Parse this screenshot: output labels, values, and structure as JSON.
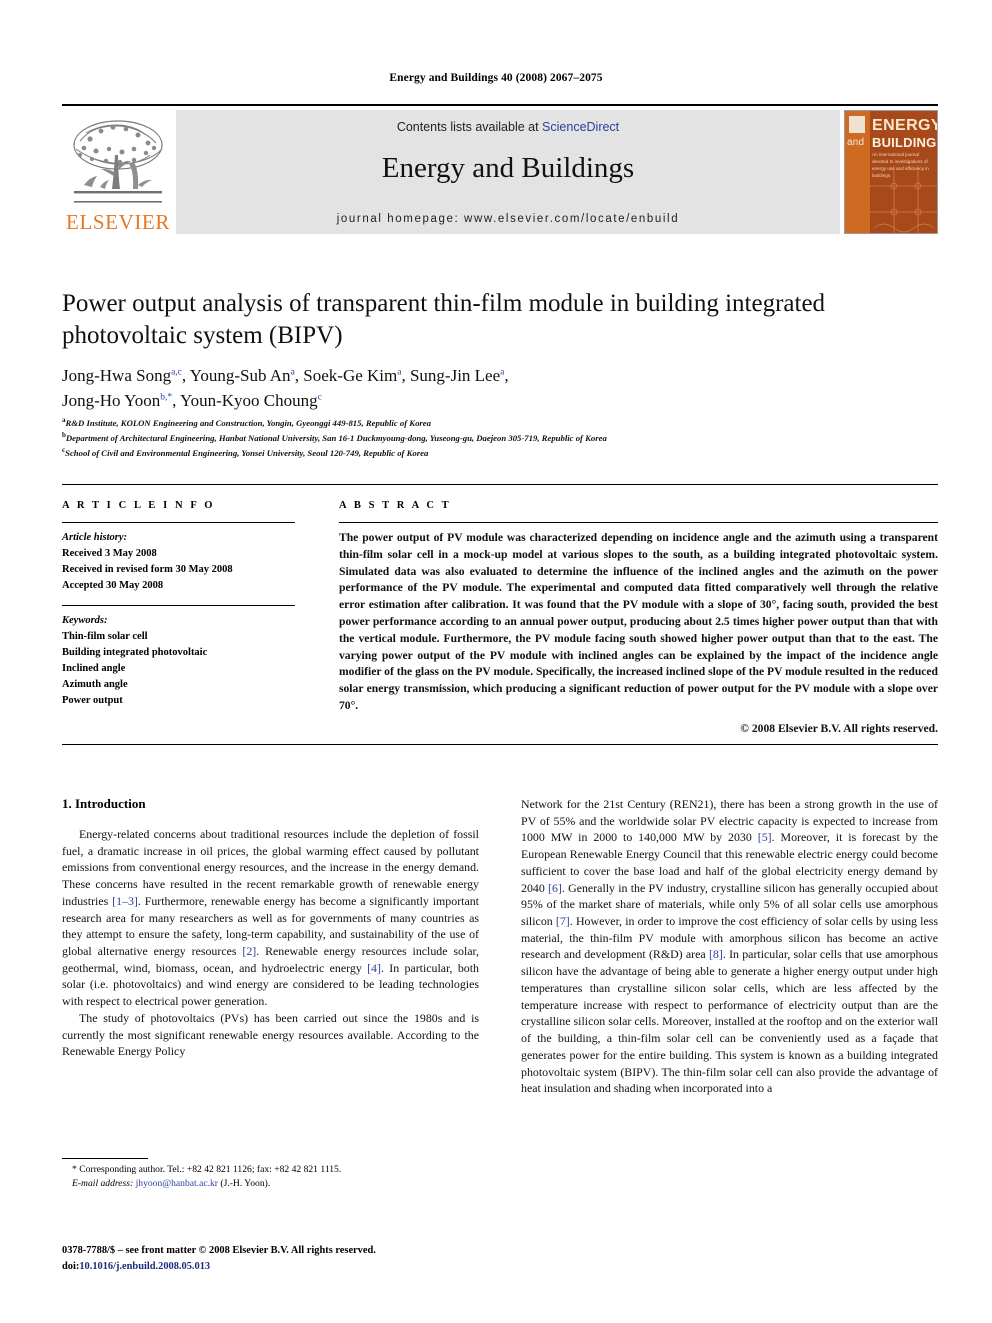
{
  "running_head": "Energy and Buildings 40 (2008) 2067–2075",
  "masthead": {
    "contents_text": "Contents lists available at ",
    "sciencedirect": "ScienceDirect",
    "journal_name": "Energy and Buildings",
    "homepage": "journal homepage: www.elsevier.com/locate/enbuild",
    "publisher_logo_text": "ELSEVIER",
    "cover": {
      "and": "and",
      "energy": "ENERGY",
      "buildings": "BUILDINGS",
      "subtitle": "An international journal devoted to investigations of energy use and efficiency in buildings"
    }
  },
  "article": {
    "title": "Power output analysis of transparent thin-film module in building integrated photovoltaic system (BIPV)",
    "authors_line1_a": "Jong-Hwa Song",
    "authors_line1_a_sup": "a,c",
    "authors_line1_b": ", Young-Sub An",
    "authors_line1_b_sup": "a",
    "authors_line1_c": ", Soek-Ge Kim",
    "authors_line1_c_sup": "a",
    "authors_line1_d": ", Sung-Jin Lee",
    "authors_line1_d_sup": "a",
    "authors_line1_end": ",",
    "authors_line2_a": "Jong-Ho Yoon",
    "authors_line2_a_sup": "b,*",
    "authors_line2_b": ", Youn-Kyoo Choung",
    "authors_line2_b_sup": "c",
    "affiliations": [
      {
        "mark": "a",
        "text": "R&D Institute, KOLON Engineering and Construction, Yongin, Gyeonggi 449-815, Republic of Korea"
      },
      {
        "mark": "b",
        "text": "Department of Architectural Engineering, Hanbat National University, San 16-1 Duckmyoung-dong, Yuseong-gu, Daejeon 305-719, Republic of Korea"
      },
      {
        "mark": "c",
        "text": "School of Civil and Environmental Engineering, Yonsei University, Seoul 120-749, Republic of Korea"
      }
    ]
  },
  "info": {
    "heading": "A R T I C L E   I N F O",
    "history_label": "Article history:",
    "history": [
      "Received 3 May 2008",
      "Received in revised form 30 May 2008",
      "Accepted 30 May 2008"
    ],
    "keywords_label": "Keywords:",
    "keywords": [
      "Thin-film solar cell",
      "Building integrated photovoltaic",
      "Inclined angle",
      "Azimuth angle",
      "Power output"
    ]
  },
  "abstract": {
    "heading": "A B S T R A C T",
    "text": "The power output of PV module was characterized depending on incidence angle and the azimuth using a transparent thin-film solar cell in a mock-up model at various slopes to the south, as a building integrated photovoltaic system. Simulated data was also evaluated to determine the influence of the inclined angles and the azimuth on the power performance of the PV module. The experimental and computed data fitted comparatively well through the relative error estimation after calibration. It was found that the PV module with a slope of 30°, facing south, provided the best power performance according to an annual power output, producing about 2.5 times higher power output than that with the vertical module. Furthermore, the PV module facing south showed higher power output than that to the east. The varying power output of the PV module with inclined angles can be explained by the impact of the incidence angle modifier of the glass on the PV module. Specifically, the increased inclined slope of the PV module resulted in the reduced solar energy transmission, which producing a significant reduction of power output for the PV module with a slope over 70°.",
    "copyright": "© 2008 Elsevier B.V. All rights reserved."
  },
  "body": {
    "section_title": "1. Introduction",
    "left_p1_a": "Energy-related concerns about traditional resources include the depletion of fossil fuel, a dramatic increase in oil prices, the global warming effect caused by pollutant emissions from conventional energy resources, and the increase in the energy demand. These concerns have resulted in the recent remarkable growth of renewable energy industries ",
    "left_p1_r1": "[1–3]",
    "left_p1_b": ". Furthermore, renewable energy has become a significantly important research area for many researchers as well as for governments of many countries as they attempt to ensure the safety, long-term capability, and sustainability of the use of global alternative energy resources ",
    "left_p1_r2": "[2]",
    "left_p1_c": ". Renewable energy resources include solar, geothermal, wind, biomass, ocean, and hydroelectric energy ",
    "left_p1_r3": "[4]",
    "left_p1_d": ". In particular, both solar (i.e. photovoltaics) and wind energy are considered to be leading technologies with respect to electrical power generation.",
    "left_p2": "The study of photovoltaics (PVs) has been carried out since the 1980s and is currently the most significant renewable energy resources available. According to the Renewable Energy Policy",
    "right_a": "Network for the 21st Century (REN21), there has been a strong growth in the use of PV of 55% and the worldwide solar PV electric capacity is expected to increase from 1000 MW in 2000 to 140,000 MW by 2030 ",
    "right_r1": "[5]",
    "right_b": ". Moreover, it is forecast by the European Renewable Energy Council that this renewable electric energy could become sufficient to cover the base load and half of the global electricity energy demand by 2040 ",
    "right_r2": "[6]",
    "right_c": ". Generally in the PV industry, crystalline silicon has generally occupied about 95% of the market share of materials, while only 5% of all solar cells use amorphous silicon ",
    "right_r3": "[7]",
    "right_d": ". However, in order to improve the cost efficiency of solar cells by using less material, the thin-film PV module with amorphous silicon has become an active research and development (R&D) area ",
    "right_r4": "[8]",
    "right_e": ". In particular, solar cells that use amorphous silicon have the advantage of being able to generate a higher energy output under high temperatures than crystalline silicon solar cells, which are less affected by the temperature increase with respect to performance of electricity output than are the crystalline silicon solar cells. Moreover, installed at the rooftop and on the exterior wall of the building, a thin-film solar cell can be conveniently used as a façade that generates power for the entire building. This system is known as a building integrated photovoltaic system (BIPV). The thin-film solar cell can also provide the advantage of heat insulation and shading when incorporated into a"
  },
  "footnotes": {
    "corresponding": "Corresponding author. Tel.: +82 42 821 1126; fax: +82 42 821 1115.",
    "email_label": "E-mail address:",
    "email": "jhyoon@hanbat.ac.kr",
    "email_owner": "(J.-H. Yoon).",
    "issn_line": "0378-7788/$ – see front matter © 2008 Elsevier B.V. All rights reserved.",
    "doi_label": "doi:",
    "doi": "10.1016/j.enbuild.2008.05.013"
  }
}
